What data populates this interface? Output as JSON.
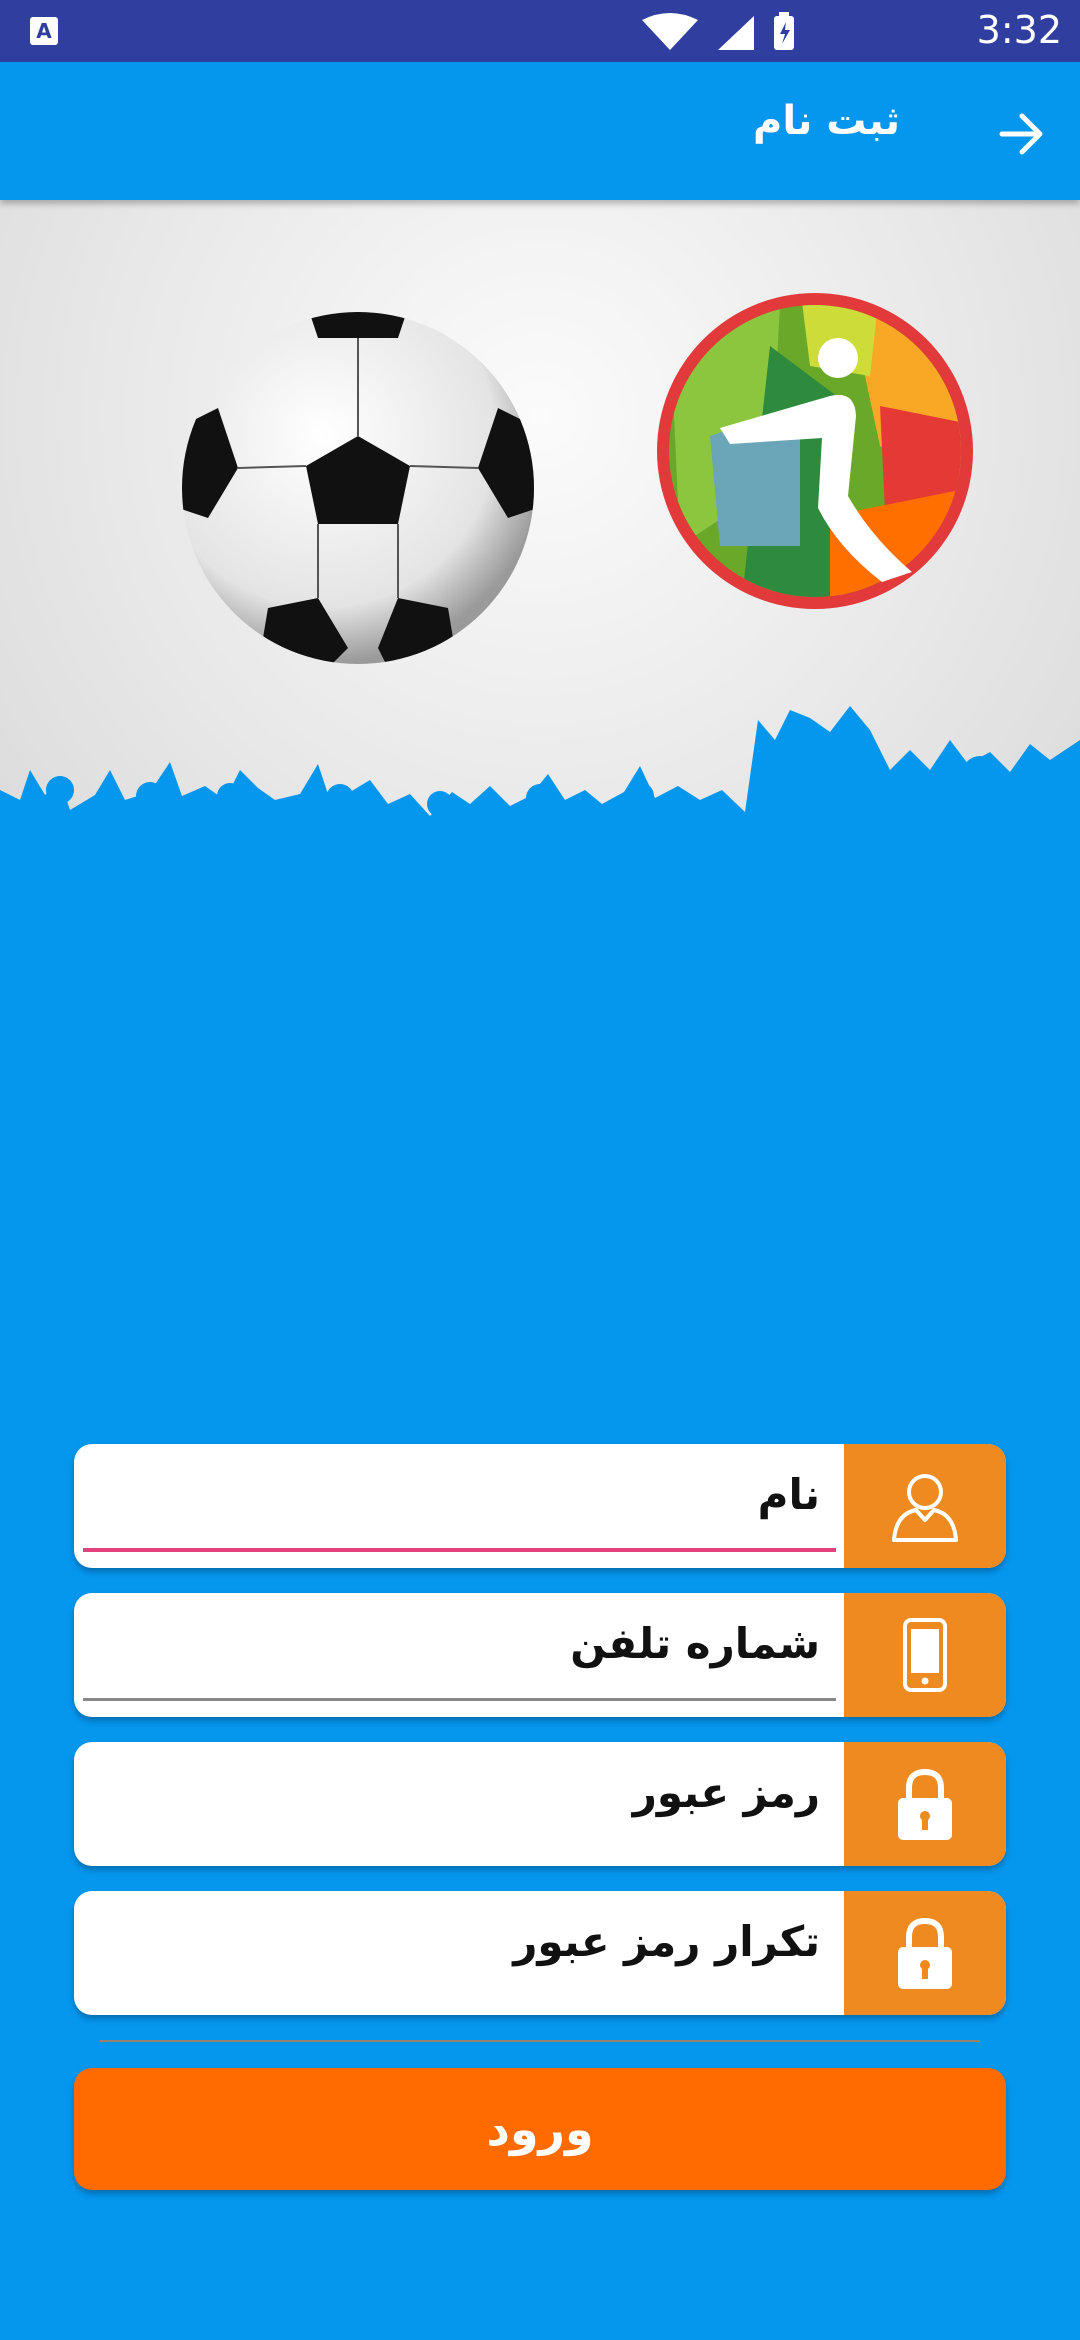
{
  "status_bar": {
    "time": "3:32",
    "notification_icon": "A"
  },
  "app_bar": {
    "title": "ثبت نام",
    "back_icon": "arrow-right-icon"
  },
  "form": {
    "name_placeholder": "نام",
    "phone_placeholder": "شماره تلفن",
    "password_placeholder": "رمز عبور",
    "repeat_password_placeholder": "تکرار رمز عبور",
    "submit_label": "ورود"
  },
  "colors": {
    "primary": "#0596ee",
    "status_bar": "#303f9f",
    "icon_box": "#ee8a1f",
    "button": "#ff6b00",
    "focus_line": "#e4407b"
  }
}
